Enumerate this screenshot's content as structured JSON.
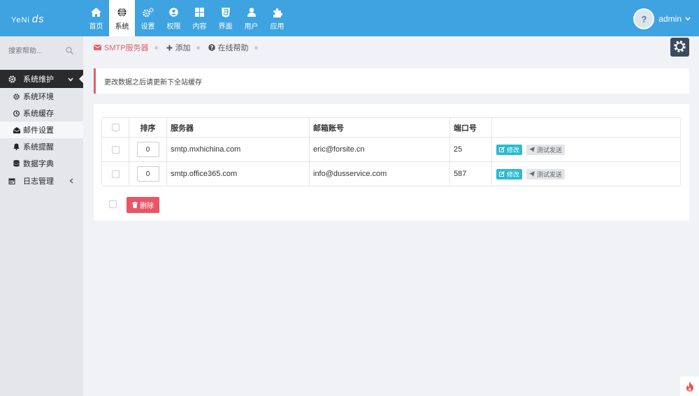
{
  "brand": {
    "logo_left": "YeNi",
    "logo_right": "ds"
  },
  "nav": [
    {
      "label": "首页",
      "icon": "home-icon"
    },
    {
      "label": "系统",
      "icon": "globe-icon",
      "active": true
    },
    {
      "label": "设置",
      "icon": "cogs-icon"
    },
    {
      "label": "权限",
      "icon": "user-circle-icon"
    },
    {
      "label": "内容",
      "icon": "grid-icon"
    },
    {
      "label": "界面",
      "icon": "html5-icon"
    },
    {
      "label": "用户",
      "icon": "user-icon"
    },
    {
      "label": "应用",
      "icon": "puzzle-icon"
    }
  ],
  "user": {
    "name": "admin",
    "avatar_text": "?"
  },
  "sidebar": {
    "search_placeholder": "搜索帮助...",
    "group_active": {
      "label": "系统维护",
      "icon": "gear-icon"
    },
    "items": [
      {
        "label": "系统环境",
        "icon": "cog-icon"
      },
      {
        "label": "系统缓存",
        "icon": "clock-icon"
      },
      {
        "label": "邮件设置",
        "icon": "envelope-open-icon",
        "current": true
      },
      {
        "label": "系统提醒",
        "icon": "bell-icon"
      },
      {
        "label": "数据字典",
        "icon": "database-icon"
      }
    ],
    "group_log": {
      "label": "日志管理",
      "icon": "calendar-icon"
    }
  },
  "breadcrumbs": [
    {
      "label": "SMTP服务器",
      "icon": "envelope-icon",
      "active": true
    },
    {
      "label": "添加",
      "icon": "plus-icon"
    },
    {
      "label": "在线帮助",
      "icon": "question-circle-icon"
    }
  ],
  "alert": {
    "text": "更改数据之后请更新下全站缓存"
  },
  "table": {
    "headers": [
      "排序",
      "服务器",
      "邮箱账号",
      "端口号"
    ],
    "rows": [
      {
        "order": "0",
        "server": "smtp.mxhichina.com",
        "account": "eric@forsite.cn",
        "port": "25"
      },
      {
        "order": "0",
        "server": "smtp.office365.com",
        "account": "info@dusservice.com",
        "port": "587"
      }
    ],
    "edit_label": "修改",
    "test_label": "测试发送"
  },
  "actions": {
    "delete_label": "删除"
  },
  "colors": {
    "topbar": "#3ea3e0",
    "accent_red": "#e95566",
    "edit_cyan": "#2bbbd0",
    "sidebar_active": "#2b2b2b"
  }
}
